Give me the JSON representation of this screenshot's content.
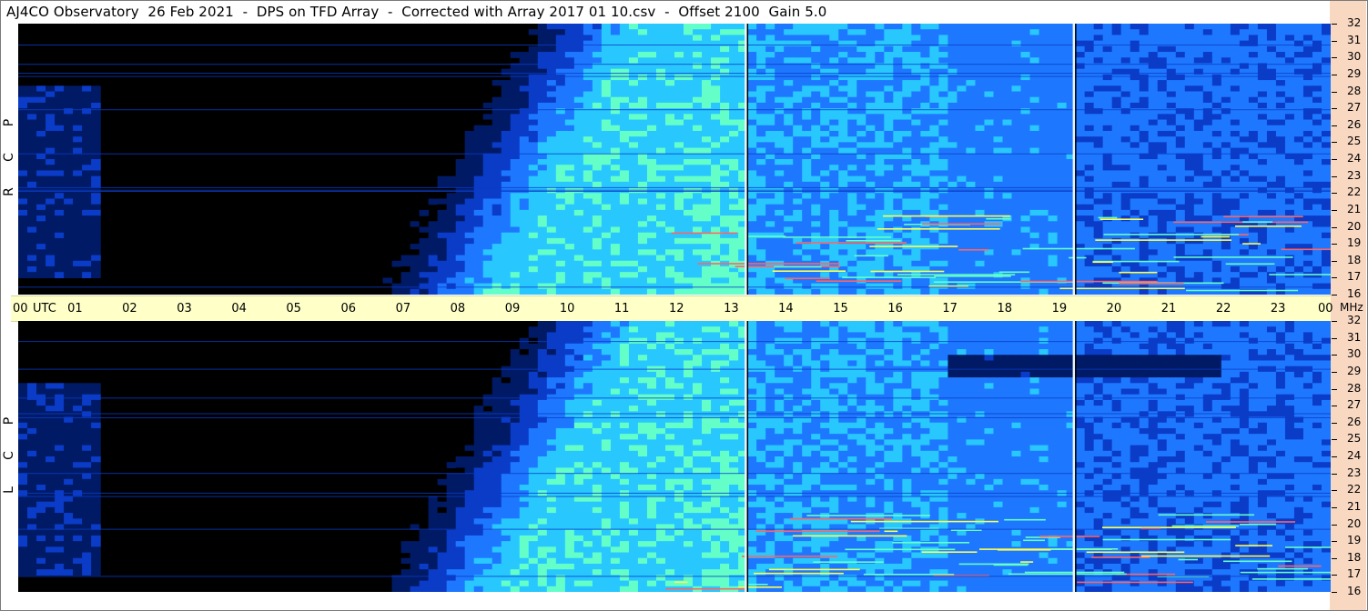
{
  "title": "AJ4CO Observatory  26 Feb 2021  -  DPS on TFD Array  -  Corrected with Array 2017 01 10.csv  -  Offset 2100  Gain 5.0",
  "chart_data": {
    "type": "heatmap",
    "title": "AJ4CO Observatory  26 Feb 2021  -  DPS on TFD Array  -  Corrected with Array 2017 01 10.csv  -  Offset 2100  Gain 5.0",
    "x_axis": {
      "range": [
        0,
        24
      ],
      "tick_labels": [
        "00",
        "01",
        "02",
        "03",
        "04",
        "05",
        "06",
        "07",
        "08",
        "09",
        "10",
        "11",
        "12",
        "13",
        "14",
        "15",
        "16",
        "17",
        "18",
        "19",
        "20",
        "21",
        "22",
        "23",
        "00"
      ],
      "start_unit": "UTC"
    },
    "y_axis": {
      "range": [
        16,
        32
      ],
      "tick_labels": [
        "32",
        "31",
        "30",
        "29",
        "28",
        "27",
        "26",
        "25",
        "24",
        "23",
        "22",
        "21",
        "20",
        "19",
        "18",
        "17",
        "16"
      ],
      "unit": "MHz"
    },
    "panels": [
      {
        "label_letters": [
          "P",
          "C",
          "R"
        ]
      },
      {
        "label_letters": [
          "P",
          "C",
          "L"
        ]
      }
    ],
    "colormap": [
      "#000000",
      "#001a66",
      "#0a3cc8",
      "#1e78ff",
      "#28c8ff",
      "#64ffc8",
      "#ffff50",
      "#ff6464"
    ],
    "vertical_markers_utc": [
      13.3,
      19.3
    ]
  }
}
